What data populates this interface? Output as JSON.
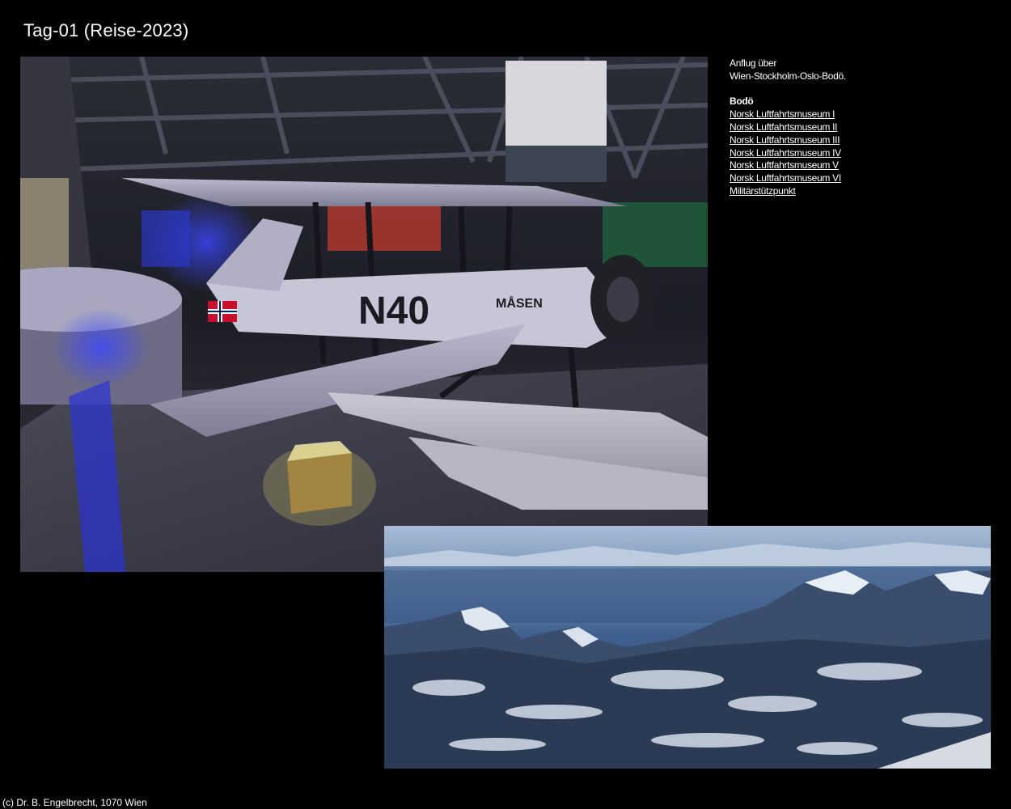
{
  "page": {
    "title": "Tag-01 (Reise-2023)"
  },
  "photos": {
    "museum": {
      "plane_registration": "N40",
      "plane_name": "MÅSEN"
    }
  },
  "sidebar": {
    "intro_line1": "Anflug über",
    "intro_line2": "Wien-Stockholm-Oslo-Bodö.",
    "heading": "Bodö",
    "links": [
      "Norsk Luftfahrtsmuseum I",
      "Norsk Luftfahrtsmuseum II",
      "Norsk Luftfahrtsmuseum III",
      "Norsk Luftfahrtsmuseum IV",
      "Norsk Luftfahrtsmuseum V",
      "Norsk Luftfahrtsmuseum VI",
      "Militärstützpunkt"
    ]
  },
  "footer": {
    "copyright": "(c) Dr. B. Engelbrecht, 1070 Wien"
  }
}
